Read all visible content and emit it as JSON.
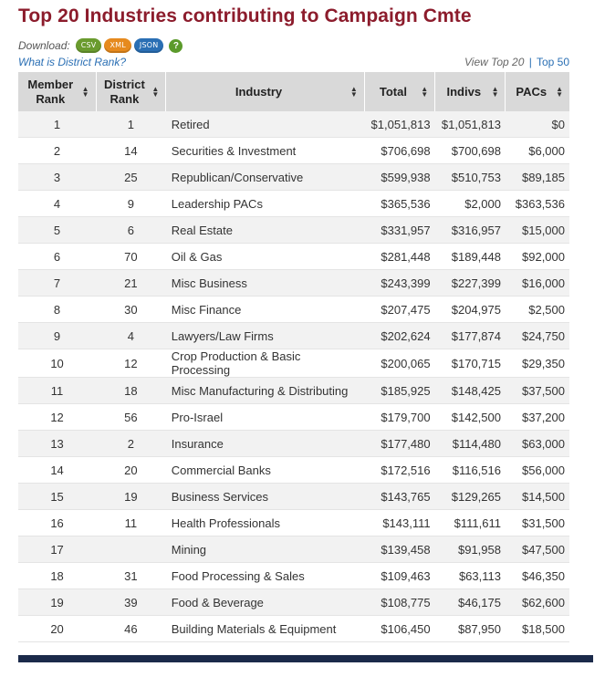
{
  "title": "Top 20 Industries contributing to Campaign Cmte",
  "download": {
    "label": "Download:",
    "formats": [
      "CSV",
      "XML",
      "JSON"
    ],
    "help": "?"
  },
  "district_rank_link": "What is District Rank?",
  "view": {
    "current": "View Top 20",
    "separator": "|",
    "alternate": "Top 50"
  },
  "table": {
    "columns": [
      "Member Rank",
      "District Rank",
      "Industry",
      "Total",
      "Indivs",
      "PACs"
    ],
    "rows": [
      [
        "1",
        "1",
        "Retired",
        "$1,051,813",
        "$1,051,813",
        "$0"
      ],
      [
        "2",
        "14",
        "Securities & Investment",
        "$706,698",
        "$700,698",
        "$6,000"
      ],
      [
        "3",
        "25",
        "Republican/Conservative",
        "$599,938",
        "$510,753",
        "$89,185"
      ],
      [
        "4",
        "9",
        "Leadership PACs",
        "$365,536",
        "$2,000",
        "$363,536"
      ],
      [
        "5",
        "6",
        "Real Estate",
        "$331,957",
        "$316,957",
        "$15,000"
      ],
      [
        "6",
        "70",
        "Oil & Gas",
        "$281,448",
        "$189,448",
        "$92,000"
      ],
      [
        "7",
        "21",
        "Misc Business",
        "$243,399",
        "$227,399",
        "$16,000"
      ],
      [
        "8",
        "30",
        "Misc Finance",
        "$207,475",
        "$204,975",
        "$2,500"
      ],
      [
        "9",
        "4",
        "Lawyers/Law Firms",
        "$202,624",
        "$177,874",
        "$24,750"
      ],
      [
        "10",
        "12",
        "Crop Production & Basic Processing",
        "$200,065",
        "$170,715",
        "$29,350"
      ],
      [
        "11",
        "18",
        "Misc Manufacturing & Distributing",
        "$185,925",
        "$148,425",
        "$37,500"
      ],
      [
        "12",
        "56",
        "Pro-Israel",
        "$179,700",
        "$142,500",
        "$37,200"
      ],
      [
        "13",
        "2",
        "Insurance",
        "$177,480",
        "$114,480",
        "$63,000"
      ],
      [
        "14",
        "20",
        "Commercial Banks",
        "$172,516",
        "$116,516",
        "$56,000"
      ],
      [
        "15",
        "19",
        "Business Services",
        "$143,765",
        "$129,265",
        "$14,500"
      ],
      [
        "16",
        "11",
        "Health Professionals",
        "$143,111",
        "$111,611",
        "$31,500"
      ],
      [
        "17",
        "",
        "Mining",
        "$139,458",
        "$91,958",
        "$47,500"
      ],
      [
        "18",
        "31",
        "Food Processing & Sales",
        "$109,463",
        "$63,113",
        "$46,350"
      ],
      [
        "19",
        "39",
        "Food & Beverage",
        "$108,775",
        "$46,175",
        "$62,600"
      ],
      [
        "20",
        "46",
        "Building Materials & Equipment",
        "$106,450",
        "$87,950",
        "$18,500"
      ]
    ]
  },
  "colors": {
    "title": "#8c1c2c",
    "link": "#2a6fb4",
    "header_bg": "#d9d9d9",
    "row_alt": "#f2f2f2",
    "footer_bar": "#1b2a4a"
  }
}
